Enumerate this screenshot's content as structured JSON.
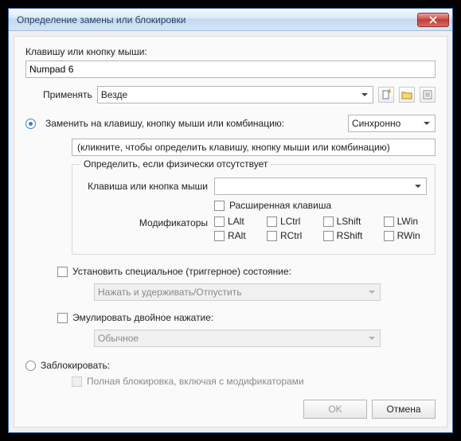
{
  "window": {
    "title": "Определение замены или блокировки"
  },
  "key_field": {
    "label": "Клавишу или кнопку мыши:",
    "value": "Numpad 6"
  },
  "apply": {
    "label": "Применять",
    "value": "Везде"
  },
  "option_replace": {
    "label": "Заменить на клавишу, кнопку мыши или комбинацию:",
    "sync": "Синхронно",
    "click_hint": "(кликните, чтобы определить клавишу, кнопку мыши или комбинацию)",
    "group_title": "Определить, если физически отсутствует",
    "key_label": "Клавиша или кнопка мыши",
    "extended": "Расширенная клавиша",
    "mods_label": "Модификаторы",
    "mods": {
      "lalt": "LAlt",
      "lctrl": "LCtrl",
      "lshift": "LShift",
      "lwin": "LWin",
      "ralt": "RAlt",
      "rctrl": "RCtrl",
      "rshift": "RShift",
      "rwin": "RWin"
    }
  },
  "trigger": {
    "label": "Установить специальное (триггерное) состояние:",
    "value": "Нажать и удерживать/Отпустить"
  },
  "double": {
    "label": "Эмулировать двойное нажатие:",
    "value": "Обычное"
  },
  "block": {
    "label": "Заблокировать:",
    "full": "Полная блокировка, включая с модификаторами"
  },
  "buttons": {
    "ok": "OK",
    "cancel": "Отмена"
  },
  "icons": {
    "new": "new-document",
    "open": "open-folder",
    "props": "properties",
    "close": "close"
  }
}
